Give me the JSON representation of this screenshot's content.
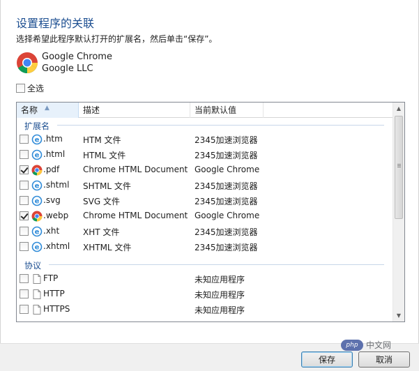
{
  "dialog": {
    "title": "设置程序的关联",
    "instruction": "选择希望此程序默认打开的扩展名，然后单击“保存”。"
  },
  "app": {
    "name": "Google Chrome",
    "vendor": "Google LLC",
    "icon": "chrome-icon"
  },
  "select_all": {
    "label": "全选",
    "checked": false
  },
  "columns": [
    "名称",
    "描述",
    "当前默认值"
  ],
  "groups": [
    {
      "label": "扩展名",
      "rows": [
        {
          "name": ".htm",
          "desc": "HTM 文件",
          "default": "2345加速浏览器",
          "checked": false,
          "icon": "ie-icon"
        },
        {
          "name": ".html",
          "desc": "HTML 文件",
          "default": "2345加速浏览器",
          "checked": false,
          "icon": "ie-icon"
        },
        {
          "name": ".pdf",
          "desc": "Chrome HTML Document",
          "default": "Google Chrome",
          "checked": true,
          "icon": "chrome-icon"
        },
        {
          "name": ".shtml",
          "desc": "SHTML 文件",
          "default": "2345加速浏览器",
          "checked": false,
          "icon": "ie-icon"
        },
        {
          "name": ".svg",
          "desc": "SVG 文件",
          "default": "2345加速浏览器",
          "checked": false,
          "icon": "ie-icon"
        },
        {
          "name": ".webp",
          "desc": "Chrome HTML Document",
          "default": "Google Chrome",
          "checked": true,
          "icon": "chrome-icon"
        },
        {
          "name": ".xht",
          "desc": "XHT 文件",
          "default": "2345加速浏览器",
          "checked": false,
          "icon": "ie-icon"
        },
        {
          "name": ".xhtml",
          "desc": "XHTML 文件",
          "default": "2345加速浏览器",
          "checked": false,
          "icon": "ie-icon"
        }
      ]
    },
    {
      "label": "协议",
      "rows": [
        {
          "name": "FTP",
          "desc": "",
          "default": "未知应用程序",
          "checked": false,
          "icon": "file-icon"
        },
        {
          "name": "HTTP",
          "desc": "",
          "default": "未知应用程序",
          "checked": false,
          "icon": "file-icon"
        },
        {
          "name": "HTTPS",
          "desc": "",
          "default": "未知应用程序",
          "checked": false,
          "icon": "file-icon"
        }
      ]
    }
  ],
  "buttons": {
    "save": "保存",
    "cancel": "取消"
  },
  "watermark": {
    "logo": "php",
    "text": "中文网"
  },
  "colors": {
    "title": "#1d4f91",
    "group": "#1d4f91",
    "footer": "#f0f0f0"
  }
}
